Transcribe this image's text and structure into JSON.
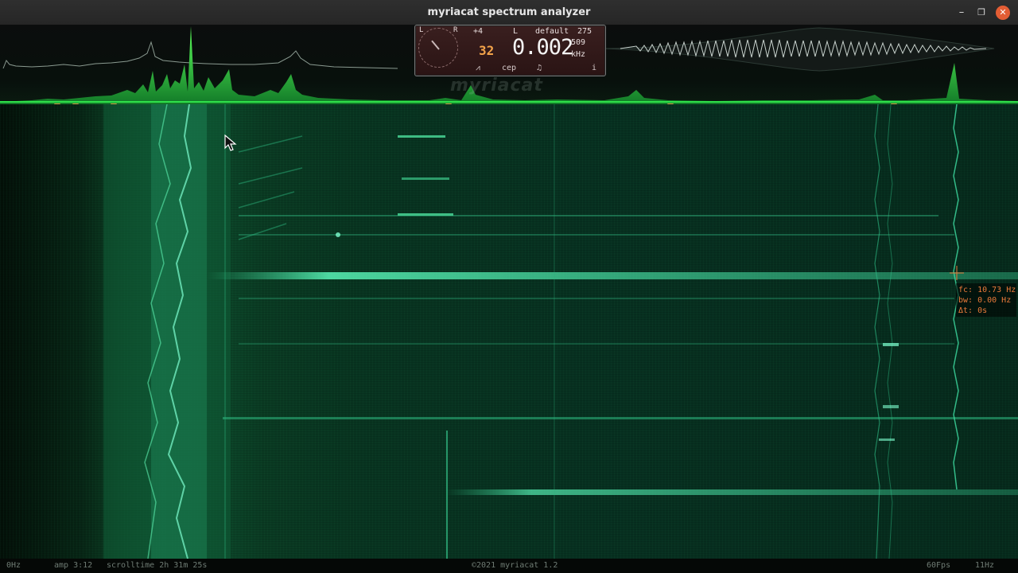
{
  "window": {
    "title": "myriacat spectrum analyzer",
    "controls": {
      "minimize": "–",
      "maximize": "❐",
      "close": "✕"
    }
  },
  "panel": {
    "dial_left": "L",
    "dial_right": "R",
    "gain": "+4",
    "channel": "L",
    "preset": "default",
    "value_a": "275",
    "value_b": "509",
    "fft_size": "32",
    "frequency": "0.002",
    "unit": "kHz",
    "buttons": {
      "wave": "⩘",
      "cep": "cep",
      "note": "♫",
      "info": "i"
    },
    "watermark": "myriacat"
  },
  "readout": {
    "fc": "fc: 10.73 Hz",
    "bw": "bw: 0.00 Hz",
    "dt": "Δt: 0s"
  },
  "status": {
    "min_freq": "0Hz",
    "amp": "amp 3:12",
    "scrolltime": "scrolltime 2h 31m 25s",
    "copyright": "©2021 myriacat 1.2",
    "fps": "60Fps",
    "max_freq": "11Hz"
  },
  "colors": {
    "accent": "#3fd24a",
    "spectrogram_bg": "#062a1c",
    "readout": "#e97a3a",
    "close_button": "#e35d34",
    "marker": "#d6b14a"
  }
}
